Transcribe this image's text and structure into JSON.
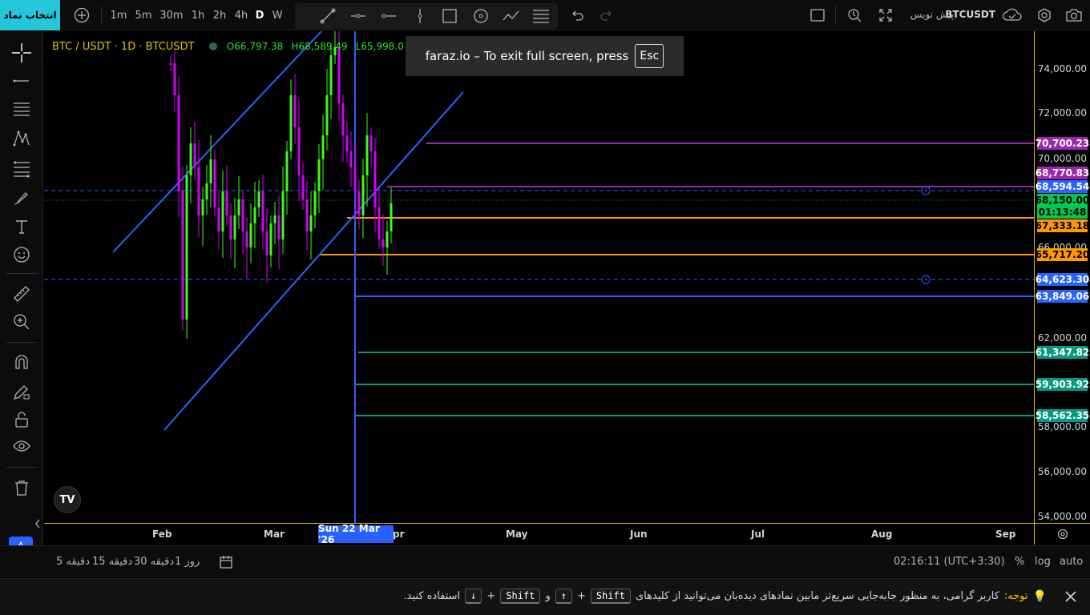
{
  "topbar": {
    "select_symbol": "انتخاب نماد",
    "intervals": [
      "1m",
      "5m",
      "30m",
      "1h",
      "2h",
      "4h",
      "D",
      "W"
    ],
    "active_interval": "D",
    "symbol": "BTCUSDT",
    "pre_post": "پیش نویس"
  },
  "legend": {
    "title": "BTC / USDT · 1D · BTCUSDT",
    "open": "O66,797.38",
    "high": "H68,589.49",
    "low": "L65,998.0"
  },
  "tv_logo": "TV",
  "fullscreen": {
    "text": "faraz.io – To exit full screen, press",
    "key": "Esc"
  },
  "price_axis": {
    "labels": [
      "74,000.00",
      "72,000.00",
      "70,000.00",
      "66,000.00",
      "62,000.00",
      "58,000.00",
      "56,000.00",
      "54,000.00"
    ],
    "tags": [
      {
        "text": "70,700.23",
        "bg": "#9c27b0",
        "fg": "#ffffff"
      },
      {
        "text": "68,770.83",
        "bg": "#9c27b0",
        "fg": "#ffffff"
      },
      {
        "text": "68,594.54",
        "bg": "#2962ff",
        "fg": "#ffffff"
      },
      {
        "text": "68,150.00",
        "bg": "#00c853",
        "fg": "#000000"
      },
      {
        "text": "01:13:48",
        "bg": "#00c853",
        "fg": "#000000"
      },
      {
        "text": "67,333.18",
        "bg": "#ff9800",
        "fg": "#000000"
      },
      {
        "text": "65,717.20",
        "bg": "#ff9800",
        "fg": "#000000"
      },
      {
        "text": "64,623.30",
        "bg": "#2962ff",
        "fg": "#ffffff"
      },
      {
        "text": "63,849.06",
        "bg": "#2962ff",
        "fg": "#ffffff"
      },
      {
        "text": "61,347.82",
        "bg": "#089981",
        "fg": "#ffffff"
      },
      {
        "text": "59,903.92",
        "bg": "#089981",
        "fg": "#ffffff"
      },
      {
        "text": "58,562.35",
        "bg": "#089981",
        "fg": "#ffffff"
      }
    ]
  },
  "time_axis": {
    "labels": [
      "Feb",
      "Mar",
      "pr",
      "May",
      "Jun",
      "Jul",
      "Aug",
      "Sep"
    ],
    "crosshair_date": "Sun 22 Mar '26"
  },
  "bottombar": {
    "ranges": [
      "5 دقیقه",
      "15 دقیقه",
      "30 دقیقه",
      "1 روز"
    ],
    "clock": "02:16:11 (UTC+3:30)",
    "percent": "%",
    "log": "log",
    "auto": "auto"
  },
  "notice": {
    "label": "توجه:",
    "text": "کاربر گرامی، به منظور جابه‌جایی سریع‌تر مابین نمادهای دیده‌بان می‌توانید از کلیدهای",
    "key1": "Shift",
    "plus1": "+",
    "key2": "↑",
    "and": "و",
    "key3": "Shift",
    "plus2": "+",
    "key4": "↓",
    "suffix": "استفاده کنید."
  },
  "colors": {
    "accent": "#26c6da",
    "bull": "#39ff14",
    "bear": "#d500f9",
    "trend": "#2962ff",
    "orange": "#ff9800",
    "purple": "#9c27b0",
    "teal": "#089981",
    "axis": "#e0c200"
  }
}
